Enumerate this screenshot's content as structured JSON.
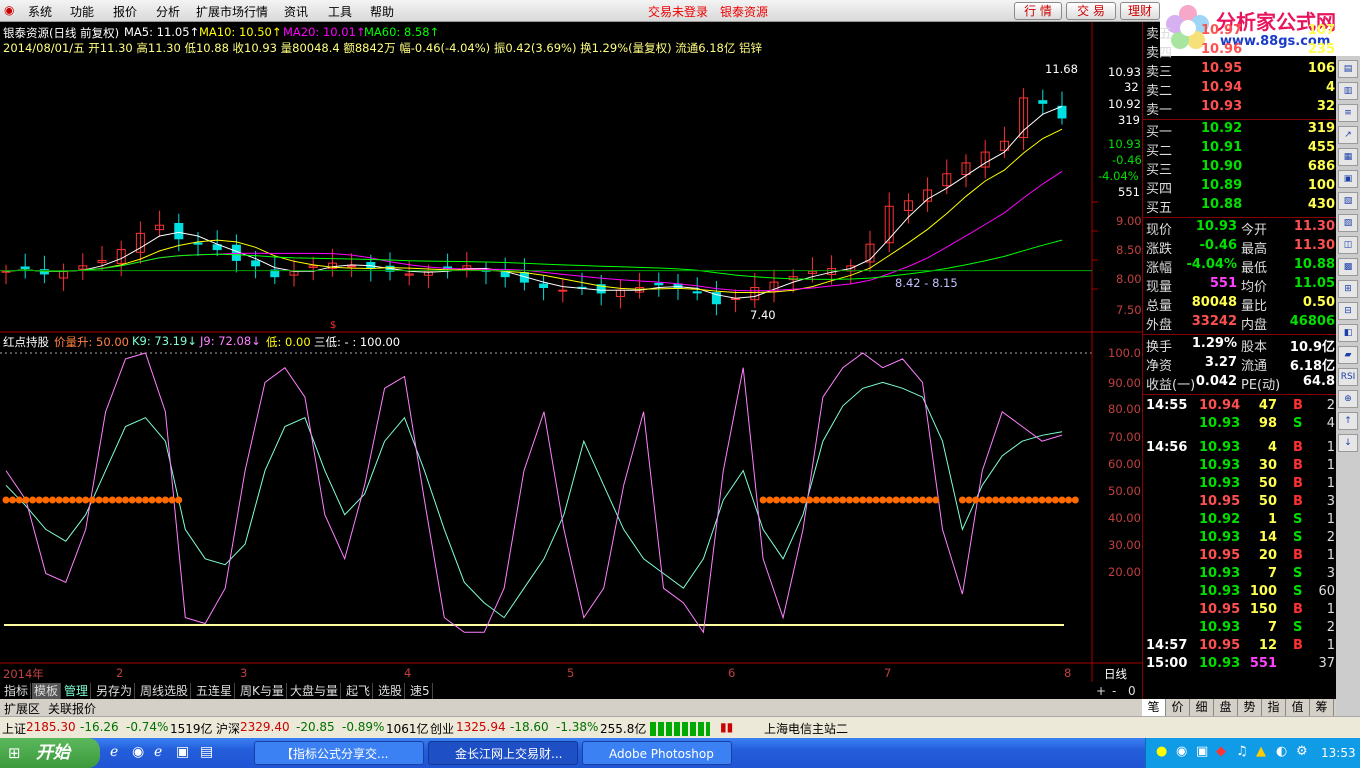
{
  "menu": {
    "items": [
      "系统",
      "功能",
      "报价",
      "分析",
      "扩展市场行情",
      "资讯",
      "工具",
      "帮助"
    ],
    "status_login": "交易未登录",
    "stock_name": "银泰资源",
    "btn_quote": "行 情",
    "btn_trade": "交 易",
    "btn_wealth": "理财"
  },
  "logo": {
    "title": "分析家公式网",
    "url": "www.88gs.com"
  },
  "chart_header": {
    "line1_title": "银泰资源(日线 前复权)",
    "ma5": "MA5: 11.05↑",
    "ma10": "MA10: 10.50↑",
    "ma20": "MA20: 10.01↑",
    "ma60": "MA60: 8.58↑",
    "line2": "2014/08/01/五 开11.30 高11.30 低10.88 收10.93 量80048.4 额8842万 幅-0.46(-4.04%) 振0.42(3.69%) 换1.29%(量复权) 流通6.18亿 铝锌"
  },
  "chart_side_labels": {
    "p1": "10.93",
    "p2": "32",
    "p3": "10.92",
    "p4": "319",
    "p5": "10.93",
    "p6": "-0.46",
    "p7": "-4.04%",
    "p8": "551"
  },
  "price_axis": [
    "9.00",
    "8.50",
    "8.00",
    "7.50"
  ],
  "annot": {
    "high": "11.68",
    "low": "7.40",
    "mid": "8.42 - 8.15"
  },
  "indicator_header": {
    "name": "红点持股",
    "a": "价量升: 50.00",
    "k": "K9: 73.19↓",
    "j": "J9: 72.08↓",
    "low": "低: 0.00",
    "three": "三低: - : 100.00"
  },
  "ind_axis": [
    "100.0",
    "90.00",
    "80.00",
    "70.00",
    "60.00",
    "50.00",
    "40.00",
    "30.00",
    "20.00"
  ],
  "x_axis": [
    "2014年",
    "2",
    "3",
    "4",
    "5",
    "6",
    "7",
    "8"
  ],
  "x_axis_right": "日线",
  "chart_data": [
    {
      "type": "line",
      "title": "银泰资源(日线 前复权)",
      "ylim": [
        7.2,
        12
      ],
      "series": [
        {
          "name": "Close",
          "values": [
            8.1,
            8.15,
            8.05,
            8.1,
            8.2,
            8.3,
            8.5,
            8.8,
            8.95,
            8.7,
            8.6,
            8.5,
            8.3,
            8.2,
            8.0,
            8.1,
            8.2,
            8.25,
            8.2,
            8.15,
            8.1,
            8.05,
            8.1,
            8.15,
            8.2,
            8.1,
            8.0,
            7.9,
            7.8,
            7.75,
            7.8,
            7.7,
            7.75,
            7.8,
            7.85,
            7.8,
            7.7,
            7.5,
            7.6,
            7.8,
            7.9,
            8.0,
            8.1,
            8.15,
            8.2,
            8.6,
            9.3,
            9.4,
            9.6,
            9.9,
            10.1,
            10.3,
            10.5,
            11.3,
            11.2,
            10.93
          ]
        }
      ]
    },
    {
      "type": "line",
      "title": "红点持股",
      "ylim": [
        0,
        100
      ],
      "series": [
        {
          "name": "K9",
          "values": [
            55,
            48,
            40,
            36,
            45,
            60,
            75,
            78,
            70,
            40,
            30,
            28,
            35,
            60,
            75,
            78,
            60,
            45,
            52,
            70,
            78,
            60,
            40,
            22,
            15,
            10,
            20,
            30,
            45,
            70,
            55,
            40,
            30,
            25,
            20,
            30,
            50,
            60,
            40,
            30,
            45,
            70,
            82,
            88,
            90,
            88,
            85,
            70,
            40,
            55,
            65,
            70,
            72,
            73.19
          ]
        },
        {
          "name": "J9",
          "values": [
            60,
            50,
            25,
            22,
            40,
            80,
            98,
            100,
            80,
            10,
            8,
            20,
            60,
            90,
            95,
            85,
            45,
            30,
            55,
            88,
            92,
            50,
            10,
            5,
            5,
            20,
            60,
            80,
            40,
            10,
            20,
            55,
            80,
            20,
            15,
            5,
            60,
            95,
            30,
            10,
            40,
            85,
            95,
            100,
            95,
            98,
            90,
            40,
            18,
            60,
            80,
            75,
            70,
            72.08
          ]
        },
        {
          "name": "价量升",
          "values": [
            50,
            50,
            50,
            50,
            50,
            50,
            50,
            50,
            50,
            0,
            0,
            0,
            0,
            0,
            0,
            0,
            0,
            0,
            0,
            0,
            0,
            0,
            0,
            0,
            0,
            0,
            0,
            0,
            0,
            0,
            0,
            0,
            0,
            0,
            0,
            0,
            0,
            0,
            50,
            50,
            50,
            50,
            50,
            50,
            50,
            50,
            50,
            0,
            50,
            50,
            50,
            50,
            50,
            50
          ]
        }
      ]
    }
  ],
  "quotes": {
    "sell": [
      {
        "l": "卖五",
        "p": "10.97",
        "v": "107"
      },
      {
        "l": "卖四",
        "p": "10.96",
        "v": "235"
      },
      {
        "l": "卖三",
        "p": "10.95",
        "v": "106"
      },
      {
        "l": "卖二",
        "p": "10.94",
        "v": "4"
      },
      {
        "l": "卖一",
        "p": "10.93",
        "v": "32"
      }
    ],
    "buy": [
      {
        "l": "买一",
        "p": "10.92",
        "v": "319"
      },
      {
        "l": "买二",
        "p": "10.91",
        "v": "455"
      },
      {
        "l": "买三",
        "p": "10.90",
        "v": "686"
      },
      {
        "l": "买四",
        "p": "10.89",
        "v": "100"
      },
      {
        "l": "买五",
        "p": "10.88",
        "v": "430"
      }
    ],
    "stats": [
      {
        "a": "现价",
        "b": "10.93",
        "c": "今开",
        "d": "11.30"
      },
      {
        "a": "涨跌",
        "b": "-0.46",
        "c": "最高",
        "d": "11.30"
      },
      {
        "a": "涨幅",
        "b": "-4.04%",
        "c": "最低",
        "d": "10.88"
      },
      {
        "a": "现量",
        "b": "551",
        "c": "均价",
        "d": "11.05"
      },
      {
        "a": "总量",
        "b": "80048",
        "c": "量比",
        "d": "0.50"
      },
      {
        "a": "外盘",
        "b": "33242",
        "c": "内盘",
        "d": "46806"
      },
      {
        "a": "换手",
        "b": "1.29%",
        "c": "股本",
        "d": "10.9亿"
      },
      {
        "a": "净资",
        "b": "3.27",
        "c": "流通",
        "d": "6.18亿"
      },
      {
        "a": "收益(一)",
        "b": "0.042",
        "c": "PE(动)",
        "d": "64.8"
      }
    ],
    "ticks": [
      {
        "t": "14:55",
        "p": "10.94",
        "v": "47",
        "s": "B",
        "n": "2"
      },
      {
        "t": "",
        "p": "10.93",
        "v": "98",
        "s": "S",
        "n": "4"
      },
      {
        "t": "14:56",
        "p": "10.93",
        "v": "4",
        "s": "B",
        "n": "1"
      },
      {
        "t": "",
        "p": "10.93",
        "v": "30",
        "s": "B",
        "n": "1"
      },
      {
        "t": "",
        "p": "10.93",
        "v": "50",
        "s": "B",
        "n": "1"
      },
      {
        "t": "",
        "p": "10.95",
        "v": "50",
        "s": "B",
        "n": "3"
      },
      {
        "t": "",
        "p": "10.92",
        "v": "1",
        "s": "S",
        "n": "1"
      },
      {
        "t": "",
        "p": "10.93",
        "v": "14",
        "s": "S",
        "n": "2"
      },
      {
        "t": "",
        "p": "10.95",
        "v": "20",
        "s": "B",
        "n": "1"
      },
      {
        "t": "",
        "p": "10.93",
        "v": "7",
        "s": "S",
        "n": "3"
      },
      {
        "t": "",
        "p": "10.93",
        "v": "100",
        "s": "S",
        "n": "60"
      },
      {
        "t": "",
        "p": "10.95",
        "v": "150",
        "s": "B",
        "n": "1"
      },
      {
        "t": "",
        "p": "10.93",
        "v": "7",
        "s": "S",
        "n": "2"
      },
      {
        "t": "14:57",
        "p": "10.95",
        "v": "12",
        "s": "B",
        "n": "1"
      },
      {
        "t": "15:00",
        "p": "10.93",
        "v": "551",
        "s": "",
        "n": "37"
      }
    ]
  },
  "bottom_tabs": [
    "指标",
    "模板",
    "管理",
    "另存为",
    "周线选股",
    "五连星",
    "周K与量",
    "大盘与量",
    "起飞",
    "选股",
    "速5"
  ],
  "bottom_tabs2": [
    "扩展区",
    "关联报价"
  ],
  "right_tabs": [
    "笔",
    "价",
    "细",
    "盘",
    "势",
    "指",
    "值",
    "筹"
  ],
  "status": {
    "sh": "上证",
    "sh_v": "2185.30",
    "sh_c": "-16.26",
    "sh_p": "-0.74%",
    "sh_a": "1519亿",
    "sz": "沪深",
    "sz_v": "2329.40",
    "sz_c": "-20.85",
    "sz_p": "-0.89%",
    "sz_a": "1061亿",
    "cy": "创业",
    "cy_v": "1325.94",
    "cy_c": "-18.60",
    "cy_p": "-1.38%",
    "cy_a": "255.8亿",
    "server": "上海电信主站二"
  },
  "taskbar": {
    "start": "开始",
    "t1": "【指标公式分享交...",
    "t2": "金长江网上交易财...",
    "t3": "Adobe Photoshop",
    "clock": "13:53"
  },
  "colors": {
    "up": "#ff3232",
    "down": "#00e0e0",
    "ma5": "#ffffff",
    "ma10": "#ffff00",
    "ma20": "#ff00ff",
    "ma60": "#00ff00",
    "k": "#7fffd4",
    "j": "#ff80ff",
    "dot": "#ff6a00"
  }
}
